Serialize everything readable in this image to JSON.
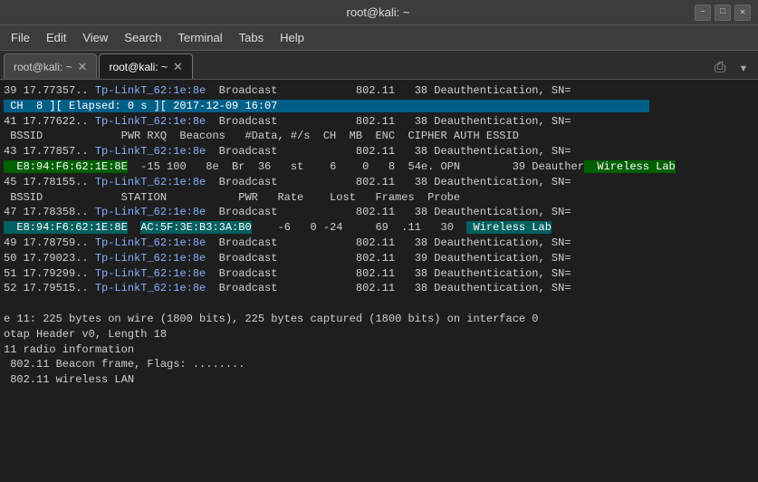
{
  "titlebar": {
    "title": "root@kali: ~",
    "minimize": "–",
    "maximize": "□",
    "close": "✕"
  },
  "menubar": {
    "items": [
      "File",
      "Edit",
      "View",
      "Search",
      "Terminal",
      "Tabs",
      "Help"
    ]
  },
  "tabs": [
    {
      "id": "tab1",
      "label": "root@kali: ~",
      "active": false
    },
    {
      "id": "tab2",
      "label": "root@kali: ~",
      "active": true
    }
  ],
  "terminal": {
    "lines": [
      "39 17.77357.. Tp-LinkT_62:1e:8e  Broadcast            802.11   38 Deauthentication, SN=",
      "CH  8 ][ Elapsed: 0 s ][ 2017-12-09 16:07",
      "41 17.77622.. Tp-LinkT_62:1e:8e  Broadcast            802.11   38 Deauthentication, SN=",
      " BSSID            PWR RXQ  Beacons   #Data, #/s  CH  MB  ENC  CIPHER AUTH ESSID",
      "43 17.77857.. Tp-LinkT_62:1e:8e  Broadcast            802.11   38 Deauthentication, SN=",
      "  E8:94:F6:62:1E:8E  -15 100   8e  Br  36   st   6    0   8  54e. OPN        39 Deauther  Wireless Lab",
      "45 17.78155.. Tp-LinkT_62:1e:8e  Broadcast            802.11   38 Deauthentication, SN=",
      " BSSID            STATION           PWR   Rate    Lost   Frames  Probe",
      "47 17.78358.. Tp-LinkT_62:1e:8e  Broadcast            802.11   38 Deauthentication, SN=",
      "  E8:94:F6:62:1E:8E  AC:5F:3E:B3:3A:B0    -6   0 -24     69  .11   30   Wireless Lab",
      "49 17.78759.. Tp-LinkT_62:1e:8e  Broadcast            802.11   38 Deauthentication, SN=",
      "50 17.79023.. Tp-LinkT_62:1e:8e  Broadcast            802.11   39 Deauthentication, SN=",
      "51 17.79299.. Tp-LinkT_62:1e:8e  Broadcast            802.11   38 Deauthentication, SN=",
      "52 17.79515.. Tp-LinkT_62:1e:8e  Broadcast            802.11   38 Deauthentication, SN=",
      "",
      "e 11: 225 bytes on wire (1800 bits), 225 bytes captured (1800 bits) on interface 0",
      "otap Header v0, Length 18",
      "11 radio information",
      " 802.11 Beacon frame, Flags: ........",
      " 802.11 wireless LAN"
    ]
  }
}
